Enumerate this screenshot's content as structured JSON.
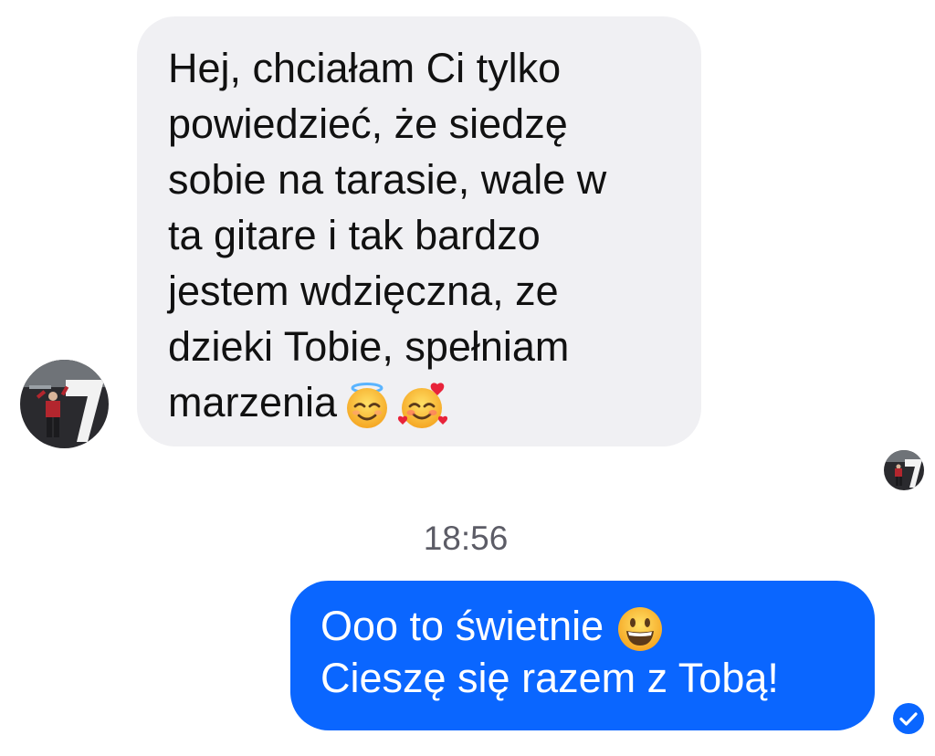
{
  "incoming_message": {
    "lines": [
      "Hej, chciałam Ci tylko",
      "powiedzieć, że siedzę",
      "sobie na tarasie, wale w",
      "ta gitare i tak bardzo",
      "jestem wdzięczna, ze",
      "dzieki Tobie, spełniam",
      "marzenia"
    ],
    "emojis": [
      "smiling-face-with-halo-icon",
      "smiling-face-with-hearts-icon"
    ]
  },
  "timestamp": "18:56",
  "outgoing_message": {
    "lines": [
      "Ooo to świetnie",
      "Cieszę się razem z Tobą!"
    ],
    "emoji": "grinning-face-icon"
  },
  "colors": {
    "incoming_bubble": "#f0f0f3",
    "outgoing_bubble": "#0a66ff",
    "incoming_text": "#111111",
    "outgoing_text": "#ffffff",
    "timestamp_text": "#5c5c66",
    "sent_indicator": "#0a66ff"
  }
}
